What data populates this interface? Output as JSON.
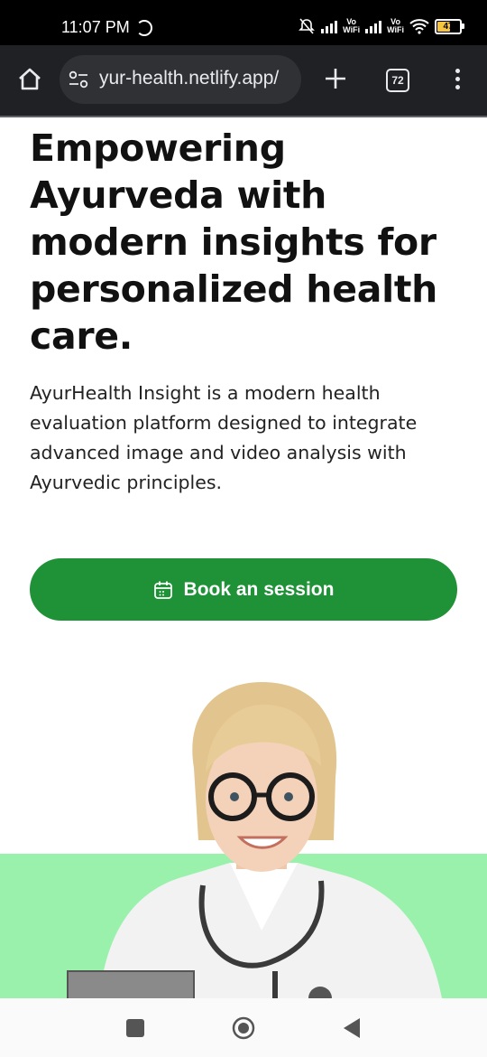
{
  "status_bar": {
    "time": "11:07 PM",
    "vo_label": "Vo",
    "wifi_label": "WiFi",
    "battery": "47"
  },
  "browser": {
    "url": "yur-health.netlify.app/",
    "tab_count": "72"
  },
  "hero": {
    "headline": "Empowering Ayurveda with modern insights for personalized health care.",
    "description": "AyurHealth Insight is a modern health evaluation platform designed to integrate advanced image and video analysis with Ayurvedic principles.",
    "cta_label": "Book an session"
  },
  "colors": {
    "cta": "#1f9136",
    "hero_band": "#9af1ac",
    "browser_bar": "#202124"
  }
}
